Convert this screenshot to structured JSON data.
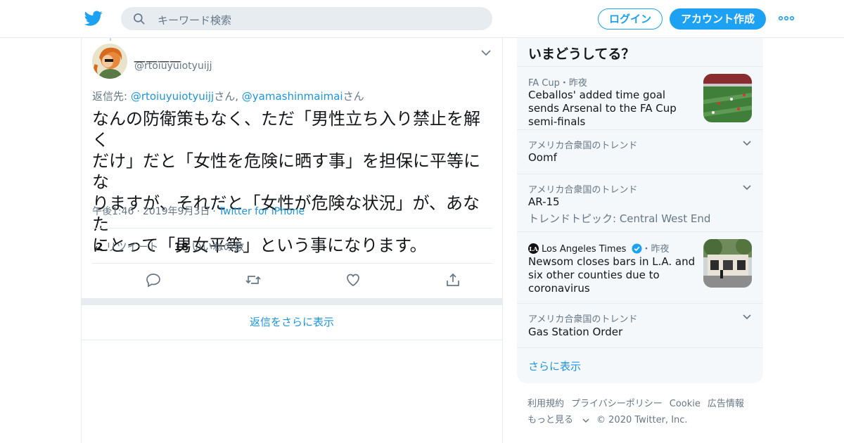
{
  "header": {
    "search_placeholder": "キーワード検索",
    "login_label": "ログイン",
    "signup_label": "アカウント作成",
    "brand_color": "#1da1f2"
  },
  "tweet": {
    "display_name": "＿＿＿＿",
    "handle": "@rtoiuyuiotyuijj",
    "reply_prefix": "返信先: ",
    "reply_to_1": "@rtoiuyuiotyuijj",
    "reply_suffix_1": "さん, ",
    "reply_to_2": "@yamashinmaimai",
    "reply_suffix_2": "さん",
    "text_lines": [
      "なんの防衛策もなく、ただ「男性立ち入り禁止を解く",
      "だけ」だと「女性を危険に晒す事」を担保に平等にな",
      "りますが、それだと「女性が危険な状況」が、あなた",
      "にとって「男女平等」という事になります。"
    ],
    "time": "午後1:46",
    "date": "2019年9月3日",
    "via": "Twitter for iPhone",
    "retweet_count": "2",
    "retweet_label": "リツイート",
    "like_count": "18",
    "like_label": "いいねの数",
    "icons": [
      "reply-icon",
      "retweet-icon",
      "like-icon",
      "share-icon"
    ]
  },
  "more_replies_label": "返信をさらに表示",
  "trends": {
    "title": "いまどうしてる？",
    "items": [
      {
        "context": "FA Cup・昨夜",
        "title": "Ceballos' added time goal sends Arsenal to the FA Cup semi-finals",
        "has_thumb": true
      },
      {
        "context": "アメリカ合衆国のトレンド",
        "title": "Oomf"
      },
      {
        "context": "アメリカ合衆国のトレンド",
        "title": "AR-15",
        "subtitle": "トレンドトピック: Central West End"
      },
      {
        "context_source": "Los Angeles Times",
        "context_time": "・昨夜",
        "title": "Newsom closes bars in L.A. and six other counties due to coronavirus",
        "has_thumb": true
      },
      {
        "context": "アメリカ合衆国のトレンド",
        "title": "Gas Station Order"
      }
    ],
    "show_more": "さらに表示"
  },
  "footer": {
    "links": [
      "利用規約",
      "プライバシーポリシー",
      "Cookie",
      "広告情報"
    ],
    "more": "もっと見る",
    "copyright": "© 2020 Twitter, Inc."
  }
}
